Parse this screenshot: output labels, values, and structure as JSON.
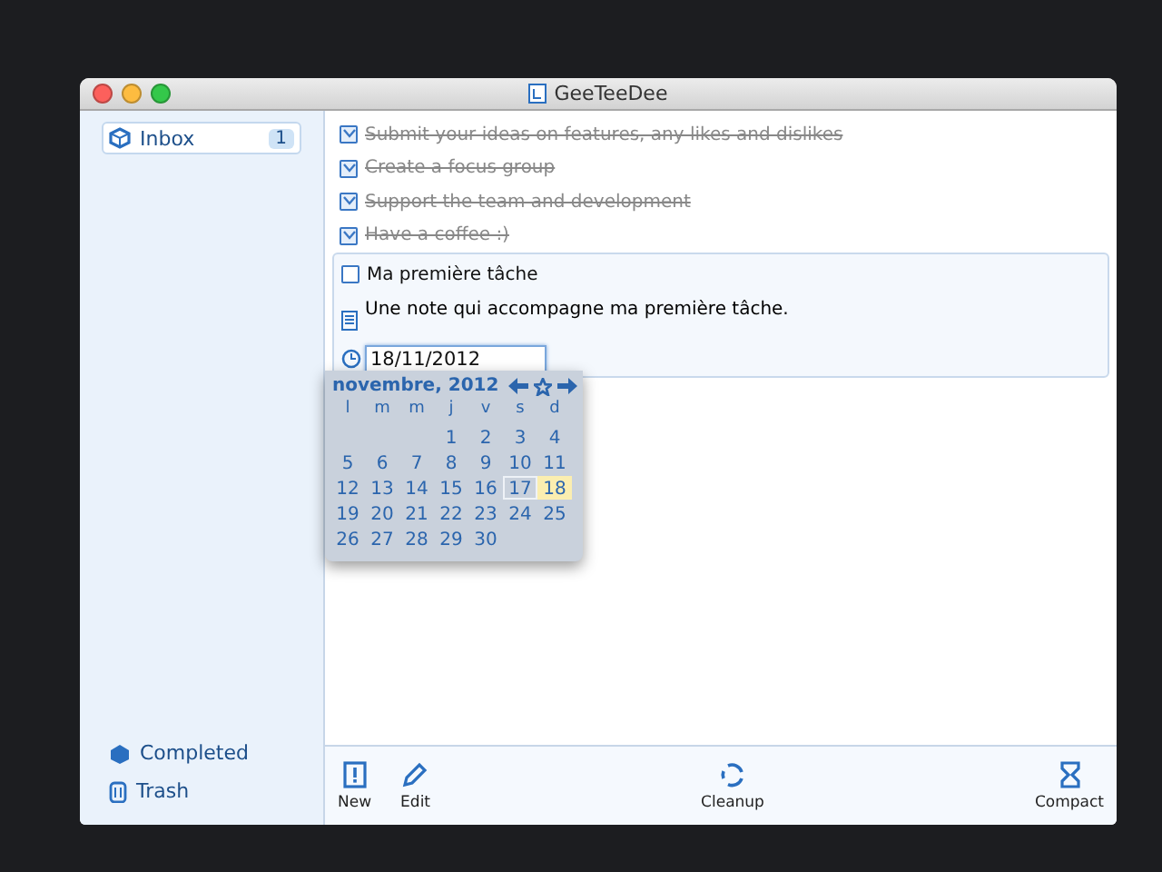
{
  "window": {
    "title": "GeeTeeDee"
  },
  "sidebar": {
    "top_items": [
      {
        "label": "Inbox",
        "count": "1",
        "selected": true
      }
    ],
    "bottom_items": [
      {
        "label": "Completed",
        "kind": "completed",
        "selected": false
      },
      {
        "label": "Trash",
        "kind": "trash",
        "selected": false
      }
    ]
  },
  "tasks": [
    {
      "title": "Submit your ideas on features, any likes and dislikes",
      "checked": true,
      "expanded": false
    },
    {
      "title": "Create a focus group",
      "checked": true,
      "expanded": false
    },
    {
      "title": "Support the team and development",
      "checked": true,
      "expanded": false
    },
    {
      "title": "Have a coffee :)",
      "checked": true,
      "expanded": false
    },
    {
      "title": "Ma première tâche",
      "checked": false,
      "expanded": true,
      "note": "Une note qui accompagne ma première tâche.",
      "date": "18/11/2012"
    }
  ],
  "calendar": {
    "month": "novembre, 2012",
    "weekdays": [
      "l",
      "m",
      "m",
      "j",
      "v",
      "s",
      "d"
    ],
    "weeks": [
      [
        {
          "label": "1",
          "selected": false,
          "today": false
        },
        {
          "label": "2",
          "selected": false,
          "today": false
        },
        {
          "label": "3",
          "selected": false,
          "today": false
        },
        {
          "label": "4",
          "selected": false,
          "today": false
        }
      ],
      [
        {
          "label": "5",
          "selected": false,
          "today": false
        },
        {
          "label": "6",
          "selected": false,
          "today": false
        },
        {
          "label": "7",
          "selected": false,
          "today": false
        },
        {
          "label": "8",
          "selected": false,
          "today": false
        },
        {
          "label": "9",
          "selected": false,
          "today": false
        },
        {
          "label": "10",
          "selected": false,
          "today": false
        },
        {
          "label": "11",
          "selected": false,
          "today": false
        }
      ],
      [
        {
          "label": "12",
          "selected": false,
          "today": false
        },
        {
          "label": "13",
          "selected": false,
          "today": false
        },
        {
          "label": "14",
          "selected": false,
          "today": false
        },
        {
          "label": "15",
          "selected": false,
          "today": false
        },
        {
          "label": "16",
          "selected": false,
          "today": false
        },
        {
          "label": "17",
          "selected": true,
          "today": false
        },
        {
          "label": "18",
          "selected": false,
          "today": true
        }
      ],
      [
        {
          "label": "19",
          "selected": false,
          "today": false
        },
        {
          "label": "20",
          "selected": false,
          "today": false
        },
        {
          "label": "21",
          "selected": false,
          "today": false
        },
        {
          "label": "22",
          "selected": false,
          "today": false
        },
        {
          "label": "23",
          "selected": false,
          "today": false
        },
        {
          "label": "24",
          "selected": false,
          "today": false
        },
        {
          "label": "25",
          "selected": false,
          "today": false
        }
      ],
      [
        {
          "label": "26",
          "selected": false,
          "today": false
        },
        {
          "label": "27",
          "selected": false,
          "today": false
        },
        {
          "label": "28",
          "selected": false,
          "today": false
        },
        {
          "label": "29",
          "selected": false,
          "today": false
        },
        {
          "label": "30",
          "selected": false,
          "today": false
        }
      ]
    ]
  },
  "toolbar": [
    {
      "label": "New",
      "kind": "new"
    },
    {
      "label": "Edit",
      "kind": "edit"
    },
    {
      "label": "Cleanup",
      "kind": "cleanup"
    },
    {
      "label": "Compact",
      "kind": "compact"
    }
  ]
}
